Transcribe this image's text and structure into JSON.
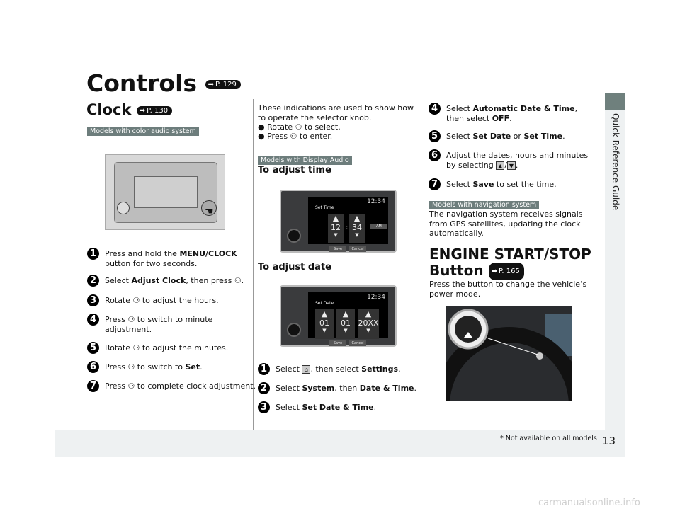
{
  "page": {
    "title": "Controls",
    "title_ref": "P. 129",
    "number": "13",
    "side_label": "Quick Reference Guide",
    "footnote": "* Not available on all models",
    "watermark": "carmanualsonline.info"
  },
  "clock": {
    "title": "Clock",
    "ref": "P. 130",
    "tag": "Models with color audio system",
    "steps": [
      {
        "n": "1",
        "pre": "Press and hold the ",
        "bold": "MENU/CLOCK",
        "post": " button for two seconds."
      },
      {
        "n": "2",
        "pre": "Select ",
        "bold": "Adjust Clock",
        "post": ", then press ⚇."
      },
      {
        "n": "3",
        "pre": "Rotate ⚆ to adjust the hours.",
        "bold": "",
        "post": ""
      },
      {
        "n": "4",
        "pre": "Press ⚇ to switch to minute adjustment.",
        "bold": "",
        "post": ""
      },
      {
        "n": "5",
        "pre": "Rotate ⚆ to adjust the minutes.",
        "bold": "",
        "post": ""
      },
      {
        "n": "6",
        "pre": "Press ⚇ to switch to ",
        "bold": "Set",
        "post": "."
      },
      {
        "n": "7",
        "pre": "Press ⚇ to complete clock adjustment.",
        "bold": "",
        "post": ""
      }
    ]
  },
  "display_audio": {
    "intro": "These indications are used to show how to operate the selector knob.",
    "bullets": [
      "Rotate ⚆ to select.",
      "Press ⚇ to enter."
    ],
    "tag": "Models with Display Audio",
    "time_heading": "To adjust time",
    "date_heading": "To adjust date",
    "time_screen": {
      "clock": "12:34",
      "title": "Set Time",
      "hour": "12",
      "minute": "34",
      "am_pm": "AM",
      "save": "Save",
      "cancel": "Cancel"
    },
    "date_screen": {
      "clock": "12:34",
      "title": "Set Date",
      "month": "01",
      "day": "01",
      "year": "20XX",
      "save": "Save",
      "cancel": "Cancel"
    },
    "steps": [
      {
        "n": "1",
        "pre": "Select ",
        "post": ", then select ",
        "bold": "Settings",
        "end": "."
      },
      {
        "n": "2",
        "pre": "Select ",
        "bold": "System",
        "mid": ", then ",
        "bold2": "Date & Time",
        "end": "."
      },
      {
        "n": "3",
        "pre": "Select ",
        "bold": "Set Date & Time",
        "end": "."
      }
    ],
    "steps2": [
      {
        "n": "4",
        "pre": "Select ",
        "bold": "Automatic Date & Time",
        "mid": ", then select ",
        "bold2": "OFF",
        "end": "."
      },
      {
        "n": "5",
        "pre": "Select ",
        "bold": "Set Date",
        "mid": " or ",
        "bold2": "Set Time",
        "end": "."
      },
      {
        "n": "6",
        "pre": "Adjust the dates, hours and minutes by selecting ",
        "end": "."
      },
      {
        "n": "7",
        "pre": "Select ",
        "bold": "Save",
        "end": " to set the time."
      }
    ]
  },
  "navigation": {
    "tag": "Models with navigation system",
    "text": "The navigation system receives signals from GPS satellites, updating the clock automatically."
  },
  "engine": {
    "title_line1": "ENGINE START/STOP",
    "title_line2": "Button",
    "ref": "P. 165",
    "text": "Press the button to change the vehicle’s power mode."
  }
}
